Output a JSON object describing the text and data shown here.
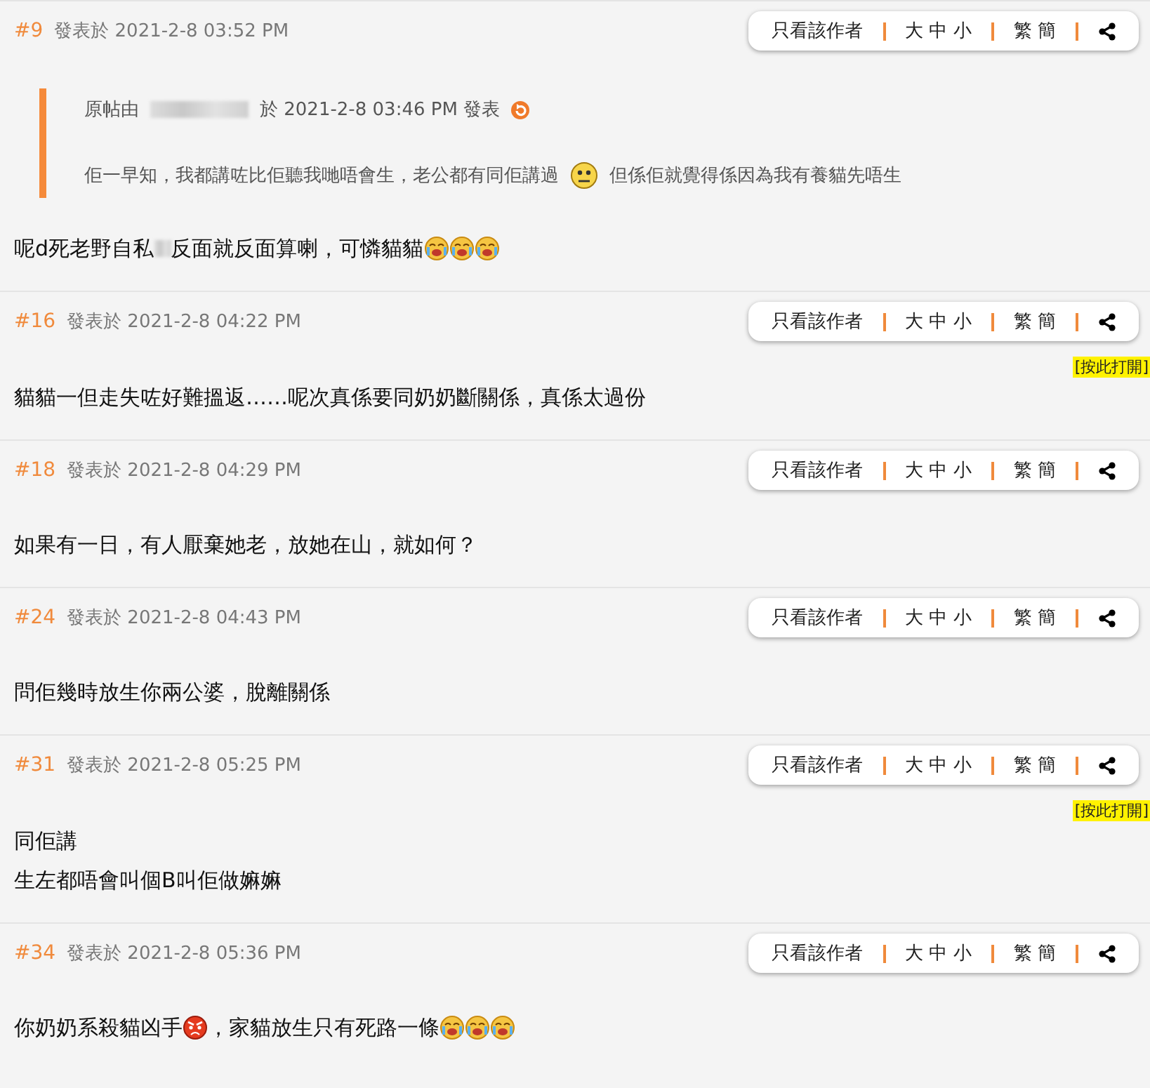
{
  "posts": [
    {
      "number": "#9",
      "posted": "發表於 2021-2-8 03:52 PM",
      "actions": [
        "只看該作者",
        "大 中 小",
        "繁 簡"
      ],
      "quote": {
        "segments": [
          {
            "kind": "text",
            "text": "原帖由"
          },
          {
            "kind": "blur"
          },
          {
            "kind": "text",
            "text": "於  2021-2-8  03:46  PM  發表"
          },
          {
            "kind": "jump"
          }
        ],
        "body": [
          {
            "kind": "text",
            "text": "佢一早知，我都講咗比佢聽我哋唔會生，老公都有同佢講過"
          },
          {
            "kind": "confused"
          },
          {
            "kind": "text",
            "text": "但係佢就覺得係因為我有養貓先唔生"
          }
        ]
      },
      "lines": [
        [
          {
            "kind": "text",
            "text": "呢d死老野自私"
          },
          {
            "kind": "blur"
          },
          {
            "kind": "text",
            "text": "反面就反面算喇，可憐貓貓"
          },
          {
            "kind": "cry"
          },
          {
            "kind": "cry"
          },
          {
            "kind": "cry"
          }
        ]
      ]
    },
    {
      "number": "#16",
      "posted": "發表於 2021-2-8 04:22 PM",
      "actions": [
        "只看該作者",
        "大 中 小",
        "繁 簡"
      ],
      "open_tag": "[按此打開]",
      "lines": [
        [
          {
            "kind": "text",
            "text": "貓貓一但走失咗好難搵返……呢次真係要同奶奶斷關係，真係太過份"
          }
        ]
      ]
    },
    {
      "number": "#18",
      "posted": "發表於 2021-2-8 04:29 PM",
      "actions": [
        "只看該作者",
        "大 中 小",
        "繁 簡"
      ],
      "lines": [
        [
          {
            "kind": "text",
            "text": "如果有一日，有人厭棄她老，放她在山，就如何？"
          }
        ]
      ]
    },
    {
      "number": "#24",
      "posted": "發表於 2021-2-8 04:43 PM",
      "actions": [
        "只看該作者",
        "大 中 小",
        "繁 簡"
      ],
      "lines": [
        [
          {
            "kind": "text",
            "text": "問佢幾時放生你兩公婆，脫離關係"
          }
        ]
      ]
    },
    {
      "number": "#31",
      "posted": "發表於 2021-2-8 05:25 PM",
      "actions": [
        "只看該作者",
        "大 中 小",
        "繁 簡"
      ],
      "open_tag": "[按此打開]",
      "lines": [
        [
          {
            "kind": "text",
            "text": "同佢講"
          }
        ],
        [
          {
            "kind": "text",
            "text": "生左都唔會叫個B叫佢做嫲嫲"
          }
        ]
      ]
    },
    {
      "number": "#34",
      "posted": "發表於 2021-2-8 05:36 PM",
      "actions": [
        "只看該作者",
        "大 中 小",
        "繁 簡"
      ],
      "lines": [
        [
          {
            "kind": "text",
            "text": "你奶奶系殺貓凶手"
          },
          {
            "kind": "angry"
          },
          {
            "kind": "text",
            "text": "，家貓放生只有死路一條"
          },
          {
            "kind": "cry"
          },
          {
            "kind": "cry"
          },
          {
            "kind": "cry"
          }
        ]
      ]
    }
  ]
}
